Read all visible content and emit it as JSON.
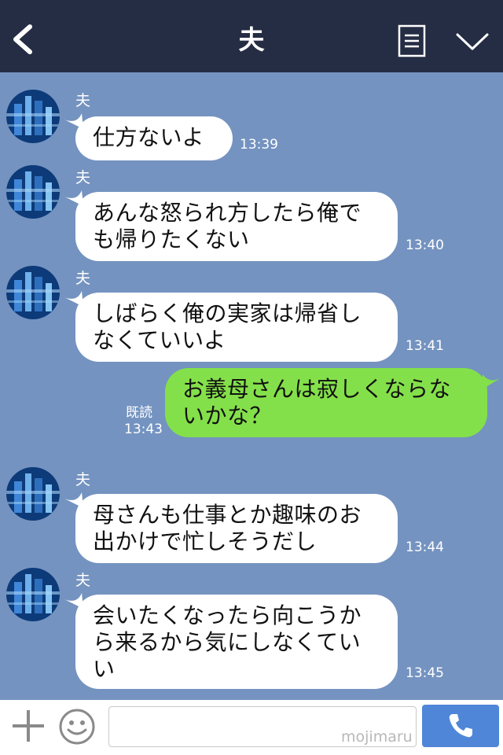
{
  "header": {
    "title": "夫",
    "back_icon": "chevron-left-icon",
    "menu_icon": "list-icon",
    "dropdown_icon": "chevron-down-icon"
  },
  "messages": [
    {
      "sender": "夫",
      "lines": [
        "仕方ないよ"
      ],
      "time": "13:39"
    },
    {
      "sender": "夫",
      "lines": [
        "あんな怒られ方したら俺で",
        "も帰りたくない"
      ],
      "time": "13:40"
    },
    {
      "sender": "夫",
      "lines": [
        "しばらく俺の実家は帰省し",
        "なくていいよ"
      ],
      "time": "13:41"
    },
    {
      "lines": [
        "お義母さんは寂しくならな",
        "いかな？"
      ],
      "read": "既読",
      "time": "13:43"
    },
    {
      "sender": "夫",
      "lines": [
        "母さんも仕事とか趣味のお",
        "出かけで忙しそうだし"
      ],
      "time": "13:44"
    },
    {
      "sender": "夫",
      "lines": [
        "会いたくなったら向こうか",
        "ら来るから気にしなくてい",
        "い"
      ],
      "time": "13:45"
    }
  ],
  "input": {
    "value": "",
    "watermark": "mojimaru"
  },
  "colors": {
    "header_bg": "#252d44",
    "chat_bg": "#7493c0",
    "incoming_bubble": "#ffffff",
    "outgoing_bubble": "#84e04a",
    "call_button": "#4f86d8"
  }
}
